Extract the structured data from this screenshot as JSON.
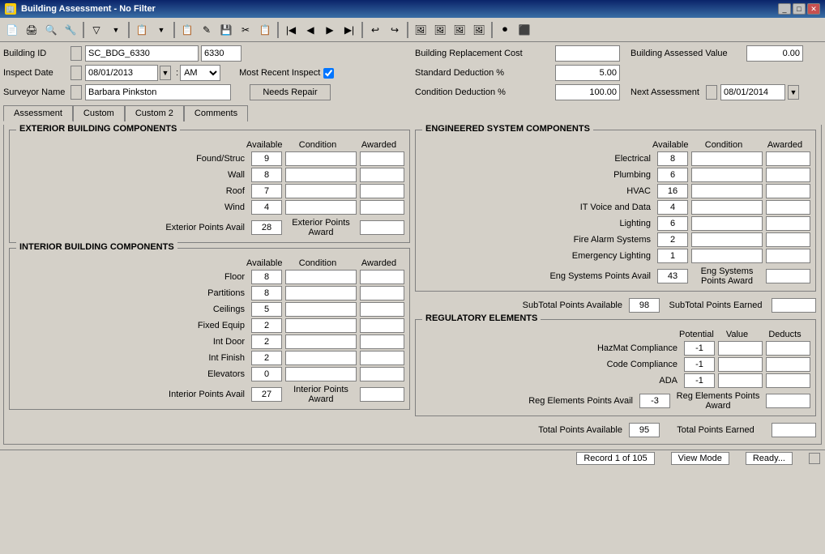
{
  "titleBar": {
    "title": "Building Assessment - No Filter",
    "icon": "🏢",
    "controls": [
      "_",
      "□",
      "✕"
    ]
  },
  "toolbar": {
    "buttons": [
      "🖨",
      "🔍",
      "📋",
      "🔧",
      "🔽",
      "▼",
      "📄",
      "▼",
      "📋",
      "✎",
      "💾",
      "✂",
      "📋",
      "◀",
      "◀",
      "▶",
      "▶▶",
      "↩",
      "↪",
      "📋",
      "📷",
      "📷",
      "📷",
      "📷",
      "🔴",
      "❌"
    ]
  },
  "fields": {
    "buildingIdLabel": "Building ID",
    "buildingIdValue": "SC_BDG_6330",
    "buildingIdNum": "6330",
    "inspectDateLabel": "Inspect Date",
    "inspectDateValue": "08/01/2013",
    "inspectTimeAMPM": "AM",
    "surveyorNameLabel": "Surveyor Name",
    "surveyorNameValue": "Barbara Pinkston",
    "mostRecentInspectLabel": "Most Recent Inspect",
    "needsRepairLabel": "Needs Repair",
    "buildingReplacementCostLabel": "Building Replacement Cost",
    "buildingReplacementCostValue": "",
    "buildingAssessedValueLabel": "Building Assessed Value",
    "buildingAssessedValueNum": "0.00",
    "standardDeductionLabel": "Standard Deduction %",
    "standardDeductionValue": "5.00",
    "conditionDeductionLabel": "Condition Deduction %",
    "conditionDeductionValue": "100.00",
    "nextAssessmentLabel": "Next Assessment",
    "nextAssessmentValue": "08/01/2014"
  },
  "tabs": [
    "Assessment",
    "Custom",
    "Custom 2",
    "Comments"
  ],
  "activeTab": "Assessment",
  "exteriorGroup": {
    "title": "EXTERIOR BUILDING COMPONENTS",
    "headers": [
      "Available",
      "Condition",
      "Awarded"
    ],
    "components": [
      {
        "name": "Found/Struc",
        "available": "9",
        "condition": "",
        "awarded": ""
      },
      {
        "name": "Wall",
        "available": "8",
        "condition": "",
        "awarded": ""
      },
      {
        "name": "Roof",
        "available": "7",
        "condition": "",
        "awarded": ""
      },
      {
        "name": "Wind",
        "available": "4",
        "condition": "",
        "awarded": ""
      }
    ],
    "totalPointsAvailLabel": "Exterior Points Avail",
    "totalPointsAvailValue": "28",
    "totalPointsAwardLabel": "Exterior Points Award",
    "totalPointsAwardValue": ""
  },
  "interiorGroup": {
    "title": "INTERIOR BUILDING COMPONENTS",
    "headers": [
      "Available",
      "Condition",
      "Awarded"
    ],
    "components": [
      {
        "name": "Floor",
        "available": "8",
        "condition": "",
        "awarded": ""
      },
      {
        "name": "Partitions",
        "available": "8",
        "condition": "",
        "awarded": ""
      },
      {
        "name": "Ceilings",
        "available": "5",
        "condition": "",
        "awarded": ""
      },
      {
        "name": "Fixed Equip",
        "available": "2",
        "condition": "",
        "awarded": ""
      },
      {
        "name": "Int Door",
        "available": "2",
        "condition": "",
        "awarded": ""
      },
      {
        "name": "Int Finish",
        "available": "2",
        "condition": "",
        "awarded": ""
      },
      {
        "name": "Elevators",
        "available": "0",
        "condition": "",
        "awarded": ""
      }
    ],
    "totalPointsAvailLabel": "Interior Points Avail",
    "totalPointsAvailValue": "27",
    "totalPointsAwardLabel": "Interior Points Award",
    "totalPointsAwardValue": ""
  },
  "engineeredGroup": {
    "title": "ENGINEERED SYSTEM COMPONENTS",
    "headers": [
      "Available",
      "Condition",
      "Awarded"
    ],
    "components": [
      {
        "name": "Electrical",
        "available": "8",
        "condition": "",
        "awarded": ""
      },
      {
        "name": "Plumbing",
        "available": "6",
        "condition": "",
        "awarded": ""
      },
      {
        "name": "HVAC",
        "available": "16",
        "condition": "",
        "awarded": ""
      },
      {
        "name": "IT Voice and Data",
        "available": "4",
        "condition": "",
        "awarded": ""
      },
      {
        "name": "Lighting",
        "available": "6",
        "condition": "",
        "awarded": ""
      },
      {
        "name": "Fire Alarm Systems",
        "available": "2",
        "condition": "",
        "awarded": ""
      },
      {
        "name": "Emergency Lighting",
        "available": "1",
        "condition": "",
        "awarded": ""
      }
    ],
    "totalPointsAvailLabel": "Eng Systems Points Avail",
    "totalPointsAvailValue": "43",
    "totalPointsAwardLabel": "Eng Systems Points Award",
    "totalPointsAwardValue": ""
  },
  "subtotal": {
    "availLabel": "SubTotal Points Available",
    "availValue": "98",
    "earnedLabel": "SubTotal Points Earned",
    "earnedValue": ""
  },
  "regulatoryGroup": {
    "title": "REGULATORY ELEMENTS",
    "headers": [
      "Potential",
      "Value",
      "Deducts"
    ],
    "components": [
      {
        "name": "HazMat Compliance",
        "potential": "-1",
        "value": "",
        "deducts": ""
      },
      {
        "name": "Code Compliance",
        "potential": "-1",
        "value": "",
        "deducts": ""
      },
      {
        "name": "ADA",
        "potential": "-1",
        "value": "",
        "deducts": ""
      }
    ],
    "totalPointsAvailLabel": "Reg Elements Points Avail",
    "totalPointsAvailValue": "-3",
    "totalPointsAwardLabel": "Reg Elements Points Award",
    "totalPointsAwardValue": ""
  },
  "totals": {
    "availLabel": "Total Points Available",
    "availValue": "95",
    "earnedLabel": "Total Points Earned",
    "earnedValue": ""
  },
  "statusBar": {
    "record": "Record 1 of 105",
    "viewMode": "View Mode",
    "status": "Ready..."
  }
}
